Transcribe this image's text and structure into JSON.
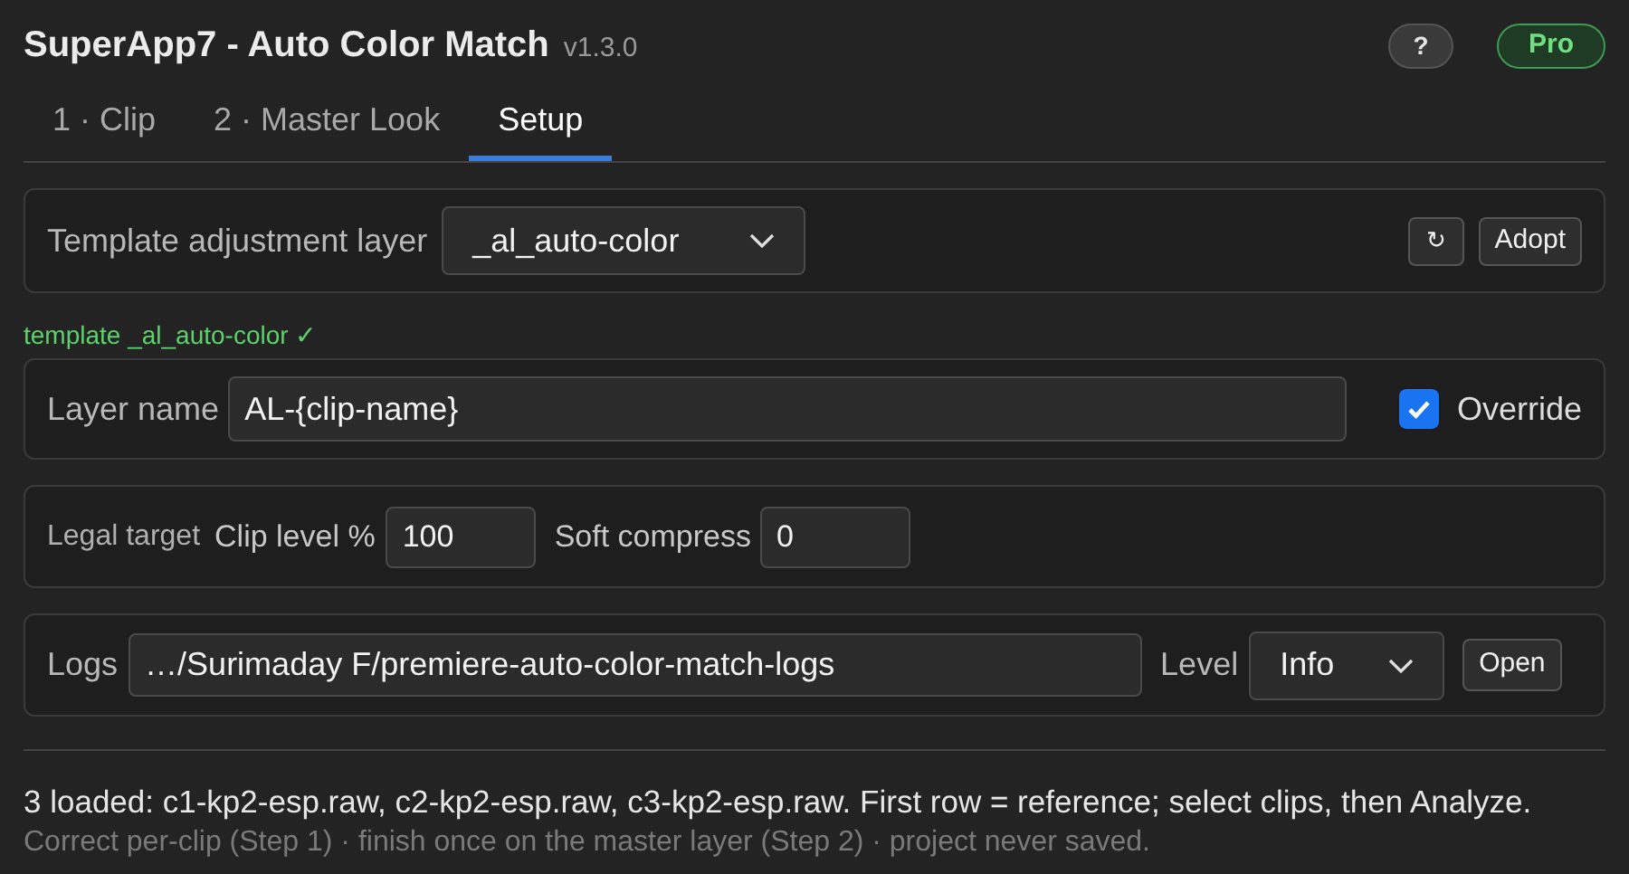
{
  "header": {
    "title": "SuperApp7 - Auto Color Match",
    "version": "v1.3.0",
    "help_button": "?",
    "plan_badge": "Pro"
  },
  "tabs": [
    {
      "label": "1 · Clip",
      "selected": false
    },
    {
      "label": "2 · Master Look",
      "selected": false
    },
    {
      "label": "Setup",
      "selected": true
    }
  ],
  "template": {
    "label": "Template adjustment layer",
    "value": "_al_auto-color",
    "refresh_button": "↻",
    "adopt_button": "Adopt",
    "status": "template _al_auto-color ✓"
  },
  "layer_name": {
    "label": "Layer name",
    "value": "AL-{clip-name}",
    "override_label": "Override",
    "override_checked": true
  },
  "legal_target": {
    "label": "Legal target",
    "clip_level_label": "Clip level %",
    "clip_level_value": "100",
    "soft_compress_label": "Soft compress",
    "soft_compress_value": "0"
  },
  "logs": {
    "label": "Logs",
    "path": "…/Surimaday F/premiere-auto-color-match-logs",
    "level_label": "Level",
    "level_value": "Info",
    "open_button": "Open"
  },
  "footer": {
    "status": "3 loaded: c1-kp2-esp.raw, c2-kp2-esp.raw, c3-kp2-esp.raw. First row = reference; select clips, then Analyze.",
    "hint": "Correct per-clip (Step 1) · finish once on the master layer (Step 2) · project never saved."
  }
}
